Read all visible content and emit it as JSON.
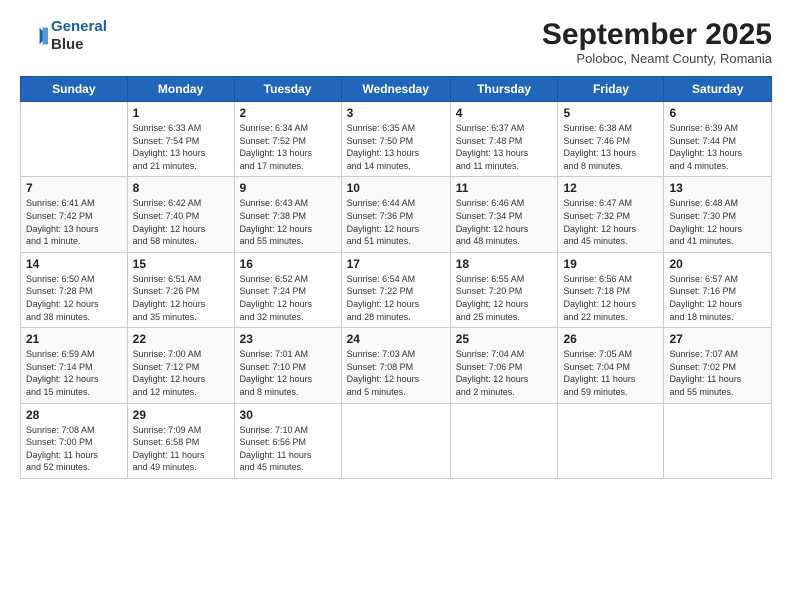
{
  "header": {
    "logo_line1": "General",
    "logo_line2": "Blue",
    "month": "September 2025",
    "location": "Poloboc, Neamt County, Romania"
  },
  "weekdays": [
    "Sunday",
    "Monday",
    "Tuesday",
    "Wednesday",
    "Thursday",
    "Friday",
    "Saturday"
  ],
  "weeks": [
    [
      {
        "day": "",
        "info": ""
      },
      {
        "day": "1",
        "info": "Sunrise: 6:33 AM\nSunset: 7:54 PM\nDaylight: 13 hours\nand 21 minutes."
      },
      {
        "day": "2",
        "info": "Sunrise: 6:34 AM\nSunset: 7:52 PM\nDaylight: 13 hours\nand 17 minutes."
      },
      {
        "day": "3",
        "info": "Sunrise: 6:35 AM\nSunset: 7:50 PM\nDaylight: 13 hours\nand 14 minutes."
      },
      {
        "day": "4",
        "info": "Sunrise: 6:37 AM\nSunset: 7:48 PM\nDaylight: 13 hours\nand 11 minutes."
      },
      {
        "day": "5",
        "info": "Sunrise: 6:38 AM\nSunset: 7:46 PM\nDaylight: 13 hours\nand 8 minutes."
      },
      {
        "day": "6",
        "info": "Sunrise: 6:39 AM\nSunset: 7:44 PM\nDaylight: 13 hours\nand 4 minutes."
      }
    ],
    [
      {
        "day": "7",
        "info": "Sunrise: 6:41 AM\nSunset: 7:42 PM\nDaylight: 13 hours\nand 1 minute."
      },
      {
        "day": "8",
        "info": "Sunrise: 6:42 AM\nSunset: 7:40 PM\nDaylight: 12 hours\nand 58 minutes."
      },
      {
        "day": "9",
        "info": "Sunrise: 6:43 AM\nSunset: 7:38 PM\nDaylight: 12 hours\nand 55 minutes."
      },
      {
        "day": "10",
        "info": "Sunrise: 6:44 AM\nSunset: 7:36 PM\nDaylight: 12 hours\nand 51 minutes."
      },
      {
        "day": "11",
        "info": "Sunrise: 6:46 AM\nSunset: 7:34 PM\nDaylight: 12 hours\nand 48 minutes."
      },
      {
        "day": "12",
        "info": "Sunrise: 6:47 AM\nSunset: 7:32 PM\nDaylight: 12 hours\nand 45 minutes."
      },
      {
        "day": "13",
        "info": "Sunrise: 6:48 AM\nSunset: 7:30 PM\nDaylight: 12 hours\nand 41 minutes."
      }
    ],
    [
      {
        "day": "14",
        "info": "Sunrise: 6:50 AM\nSunset: 7:28 PM\nDaylight: 12 hours\nand 38 minutes."
      },
      {
        "day": "15",
        "info": "Sunrise: 6:51 AM\nSunset: 7:26 PM\nDaylight: 12 hours\nand 35 minutes."
      },
      {
        "day": "16",
        "info": "Sunrise: 6:52 AM\nSunset: 7:24 PM\nDaylight: 12 hours\nand 32 minutes."
      },
      {
        "day": "17",
        "info": "Sunrise: 6:54 AM\nSunset: 7:22 PM\nDaylight: 12 hours\nand 28 minutes."
      },
      {
        "day": "18",
        "info": "Sunrise: 6:55 AM\nSunset: 7:20 PM\nDaylight: 12 hours\nand 25 minutes."
      },
      {
        "day": "19",
        "info": "Sunrise: 6:56 AM\nSunset: 7:18 PM\nDaylight: 12 hours\nand 22 minutes."
      },
      {
        "day": "20",
        "info": "Sunrise: 6:57 AM\nSunset: 7:16 PM\nDaylight: 12 hours\nand 18 minutes."
      }
    ],
    [
      {
        "day": "21",
        "info": "Sunrise: 6:59 AM\nSunset: 7:14 PM\nDaylight: 12 hours\nand 15 minutes."
      },
      {
        "day": "22",
        "info": "Sunrise: 7:00 AM\nSunset: 7:12 PM\nDaylight: 12 hours\nand 12 minutes."
      },
      {
        "day": "23",
        "info": "Sunrise: 7:01 AM\nSunset: 7:10 PM\nDaylight: 12 hours\nand 8 minutes."
      },
      {
        "day": "24",
        "info": "Sunrise: 7:03 AM\nSunset: 7:08 PM\nDaylight: 12 hours\nand 5 minutes."
      },
      {
        "day": "25",
        "info": "Sunrise: 7:04 AM\nSunset: 7:06 PM\nDaylight: 12 hours\nand 2 minutes."
      },
      {
        "day": "26",
        "info": "Sunrise: 7:05 AM\nSunset: 7:04 PM\nDaylight: 11 hours\nand 59 minutes."
      },
      {
        "day": "27",
        "info": "Sunrise: 7:07 AM\nSunset: 7:02 PM\nDaylight: 11 hours\nand 55 minutes."
      }
    ],
    [
      {
        "day": "28",
        "info": "Sunrise: 7:08 AM\nSunset: 7:00 PM\nDaylight: 11 hours\nand 52 minutes."
      },
      {
        "day": "29",
        "info": "Sunrise: 7:09 AM\nSunset: 6:58 PM\nDaylight: 11 hours\nand 49 minutes."
      },
      {
        "day": "30",
        "info": "Sunrise: 7:10 AM\nSunset: 6:56 PM\nDaylight: 11 hours\nand 45 minutes."
      },
      {
        "day": "",
        "info": ""
      },
      {
        "day": "",
        "info": ""
      },
      {
        "day": "",
        "info": ""
      },
      {
        "day": "",
        "info": ""
      }
    ]
  ]
}
